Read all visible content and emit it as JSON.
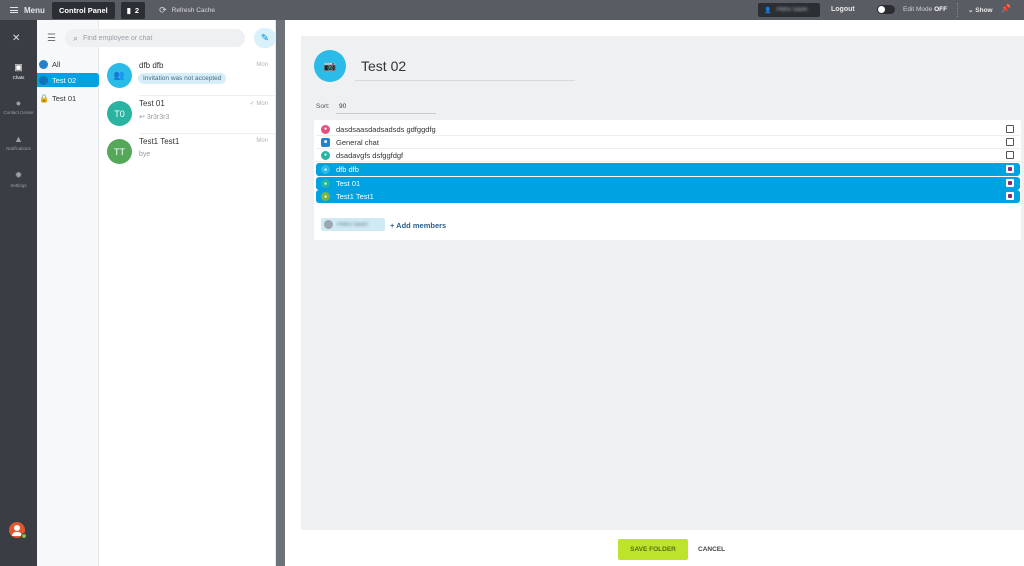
{
  "topbar": {
    "menu_label": "Menu",
    "control_panel_label": "Control Panel",
    "notifications_count": "2",
    "refresh_label": "Refresh Cache",
    "user_name": "Petro Savin",
    "logout_label": "Logout",
    "edit_mode_label": "Edit Mode",
    "edit_mode_state": "OFF",
    "show_label": "Show"
  },
  "rail": {
    "items": [
      {
        "label": "Chats",
        "icon": "chats-icon"
      },
      {
        "label": "Contact Center",
        "icon": "contact-center-icon"
      },
      {
        "label": "Notifications",
        "icon": "bell-icon"
      },
      {
        "label": "Settings",
        "icon": "gear-icon"
      }
    ]
  },
  "folders": [
    {
      "label": "All"
    },
    {
      "label": "Test 02"
    },
    {
      "label": "Test 01"
    }
  ],
  "search": {
    "placeholder": "Find employee or chat"
  },
  "chats": [
    {
      "initials": "",
      "name": "dfb dfb",
      "time": "Mon",
      "status": "Invitation was not accepted",
      "color": "#2bbbe8"
    },
    {
      "initials": "T0",
      "name": "Test 01",
      "time": "Mon",
      "message": "3r3r3r3",
      "color": "#2ab3a0"
    },
    {
      "initials": "TT",
      "name": "Test1 Test1",
      "time": "Mon",
      "message": "bye",
      "color": "#55a85a"
    }
  ],
  "folder_form": {
    "title": "Test 02",
    "sort_label": "Sort:",
    "sort_value": "90",
    "members": [
      {
        "name": "dasdsaasdadsadsds gdfggdfg",
        "selected": false,
        "color": "#e5507d"
      },
      {
        "name": "General chat",
        "selected": false,
        "color": "#2481cc"
      },
      {
        "name": "dsadavgfs dsfggfdgf",
        "selected": false,
        "color": "#2ab3a0"
      },
      {
        "name": "dfb dfb",
        "selected": true,
        "color": "#2bbbe8"
      },
      {
        "name": "Test 01",
        "selected": true,
        "color": "#2ab3a0"
      },
      {
        "name": "Test1 Test1",
        "selected": true,
        "color": "#7cb342"
      }
    ],
    "member_chip": "Petro Savin",
    "add_members_label": "+ Add members",
    "save_label": "SAVE FOLDER",
    "cancel_label": "CANCEL"
  },
  "colors": {
    "accent": "#00a2e1",
    "save": "#bde42a",
    "rail": "#3a3e44"
  }
}
